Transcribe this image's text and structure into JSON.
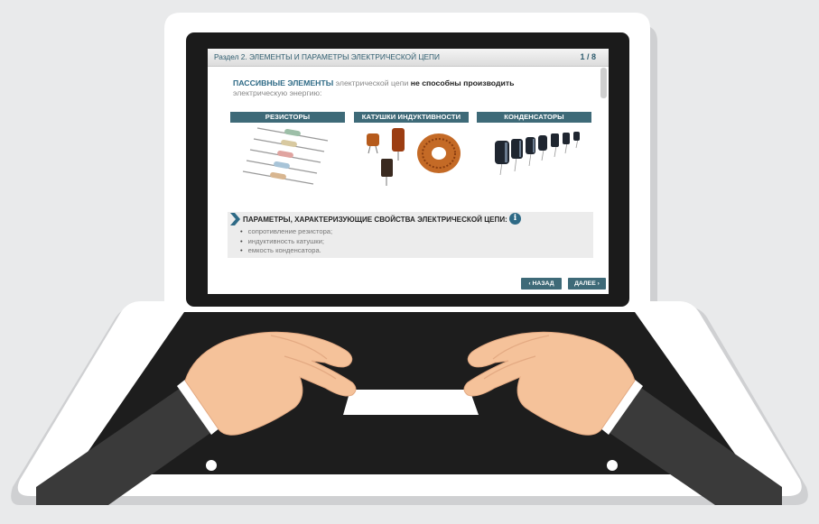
{
  "header": {
    "title": "Раздел 2. ЭЛЕМЕНТЫ И ПАРАМЕТРЫ ЭЛЕКТРИЧЕСКОЙ ЦЕПИ",
    "page": "1 / 8"
  },
  "intro": {
    "highlight": "ПАССИВНЫЕ ЭЛЕМЕНТЫ",
    "part1": " электрической цепи ",
    "bold": "не способны производить",
    "part2": "электрическую энергию:"
  },
  "components": [
    {
      "label": "РЕЗИСТОРЫ",
      "image": "resistors"
    },
    {
      "label": "КАТУШКИ ИНДУКТИВНОСТИ",
      "image": "inductors"
    },
    {
      "label": "КОНДЕНСАТОРЫ",
      "image": "capacitors"
    }
  ],
  "parameters": {
    "title": "ПАРАМЕТРЫ, ХАРАКТЕРИЗУЮЩИЕ СВОЙСТВА ЭЛЕКТРИЧЕСКОЙ ЦЕПИ:",
    "info_icon": "i",
    "items": [
      "сопротивление резистора;",
      "индуктивность катушки;",
      "емкость конденсатора."
    ]
  },
  "nav": {
    "back": "‹ НАЗАД",
    "next": "ДАЛЕЕ ›"
  },
  "colors": {
    "accent": "#3e6a78",
    "header_text": "#2f5d6f",
    "background": "#e9eaeb",
    "skin": "#f5c29a",
    "sleeve": "#3a3a3a"
  }
}
